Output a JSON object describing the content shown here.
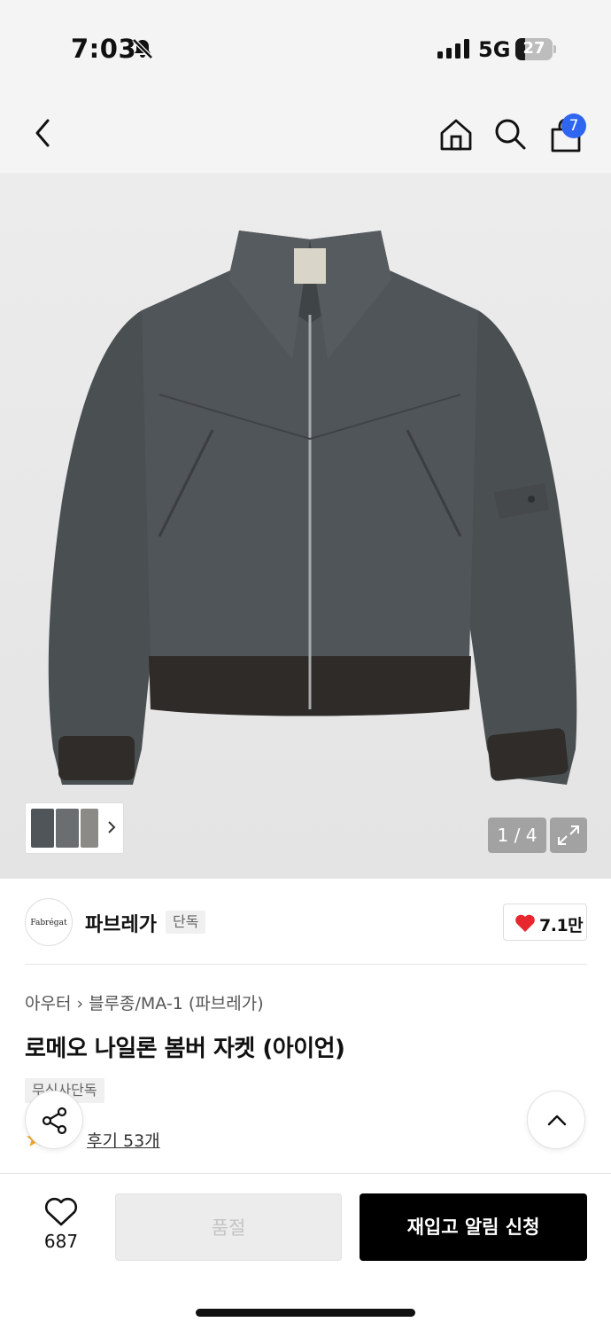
{
  "status_bar": {
    "time": "7:03",
    "network": "5G",
    "battery_level": "27",
    "icons": [
      "bell-slash-icon",
      "signal-icon",
      "battery-icon"
    ]
  },
  "header": {
    "icons": [
      "back-icon",
      "home-icon",
      "search-icon",
      "cart-icon"
    ],
    "cart_count": "7",
    "accent_color": "#2f66f0"
  },
  "gallery": {
    "page_counter": "1 / 4",
    "current_page": 1,
    "total_pages": 4,
    "icons": [
      "chevron-right-icon",
      "expand-icon"
    ]
  },
  "brand": {
    "logo_text": "Fabrégat",
    "name": "파브레가",
    "tag": "단독",
    "likes": "7.1만",
    "heart_color": "#e8262e"
  },
  "product": {
    "breadcrumb": [
      "아우터",
      "블루종/MA-1 (파브레가)"
    ],
    "title": "로메오 나일론 봄버 자켓 (아이언)",
    "tag": "무신사단독",
    "reviews": "후기 53개"
  },
  "bottom_bar": {
    "wish_count": "687",
    "soldout_label": "품절",
    "restock_label": "재입고 알림 신청"
  }
}
